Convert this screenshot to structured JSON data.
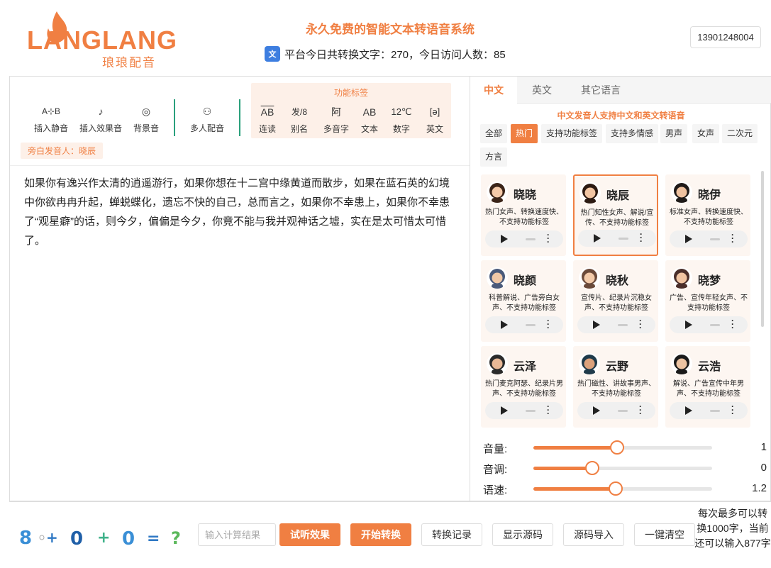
{
  "header": {
    "logo_text": "LANGLANG",
    "logo_sub": "琅琅配音",
    "site_title": "永久免费的智能文本转语音系统",
    "stats": "平台今日共转换文字：270，今日访问人数：85",
    "user_phone": "13901248004"
  },
  "toolbar": {
    "insert_silence": "插入静音",
    "insert_effect": "插入效果音",
    "background_sound": "背景音",
    "multi_voice": "多人配音",
    "func_title": "功能标签",
    "func_tags": [
      {
        "icon": "AB",
        "label": "连读"
      },
      {
        "icon": "发/8",
        "label": "别名"
      },
      {
        "icon": "阿",
        "label": "多音字"
      },
      {
        "icon": "AB",
        "label": "文本"
      },
      {
        "icon": "12℃",
        "label": "数字"
      },
      {
        "icon": "[ə]",
        "label": "英文"
      }
    ],
    "narrator_tag": "旁白发音人：晓辰"
  },
  "editor": {
    "text": "如果你有逸兴作太清的逍遥游行，如果你想在十二宫中缘黄道而散步，如果在蓝石英的幻境中你欲冉冉升起，蝉蜕蝶化，遗忘不快的自己，总而言之，如果你不幸患上，如果你不幸患了“观星癖”的话，则今夕，偏偏是今夕，你竟不能与我并观神话之墟，实在是太可惜太可惜了。"
  },
  "right": {
    "tabs": [
      "中文",
      "英文",
      "其它语言"
    ],
    "voice_note": "中文发音人支持中文和英文转语音",
    "filters": [
      "全部",
      "热门",
      "支持功能标签",
      "支持多情感",
      "男声",
      "女声",
      "二次元",
      "方言"
    ],
    "voices": [
      {
        "name": "晓晓",
        "desc": "热门女声、转换速度快、不支持功能标签",
        "avatar": "female-avatar-1"
      },
      {
        "name": "晓辰",
        "desc": "热门知性女声、解说/宣传、不支持功能标签",
        "avatar": "female-avatar-2"
      },
      {
        "name": "晓伊",
        "desc": "标准女声、转换速度快、不支持功能标签",
        "avatar": "female-avatar-3"
      },
      {
        "name": "晓颜",
        "desc": "科普解说、广告旁白女声、不支持功能标签",
        "avatar": "female-avatar-4"
      },
      {
        "name": "晓秋",
        "desc": "宣传片、纪录片沉稳女声、不支持功能标签",
        "avatar": "female-avatar-5"
      },
      {
        "name": "晓梦",
        "desc": "广告、宣传年轻女声、不支持功能标签",
        "avatar": "female-avatar-6"
      },
      {
        "name": "云泽",
        "desc": "热门麦克阿瑟、纪录片男声、不支持功能标签",
        "avatar": "male-avatar-1"
      },
      {
        "name": "云野",
        "desc": "热门磁性、讲故事男声、不支持功能标签",
        "avatar": "male-avatar-2"
      },
      {
        "name": "云浩",
        "desc": "解说、广告宣传中年男声、不支持功能标签",
        "avatar": "male-avatar-3"
      }
    ],
    "selected_voice": "晓辰",
    "sliders": [
      {
        "label": "音量:",
        "value": "1",
        "fraction": 0.47
      },
      {
        "label": "音调:",
        "value": "0",
        "fraction": 0.33
      },
      {
        "label": "语速:",
        "value": "1.2",
        "fraction": 0.46
      }
    ]
  },
  "bottom": {
    "captcha": "8◦+0+0=?",
    "calc_placeholder": "输入计算结果",
    "buttons": [
      "试听效果",
      "开始转换",
      "转换记录",
      "显示源码",
      "源码导入",
      "一键清空"
    ],
    "limit_note": "每次最多可以转换1000字，当前还可以输入877字"
  },
  "colors": {
    "accent": "#f07f42",
    "accent_light": "#fdf0e8",
    "divider_green": "#2aa07c"
  }
}
